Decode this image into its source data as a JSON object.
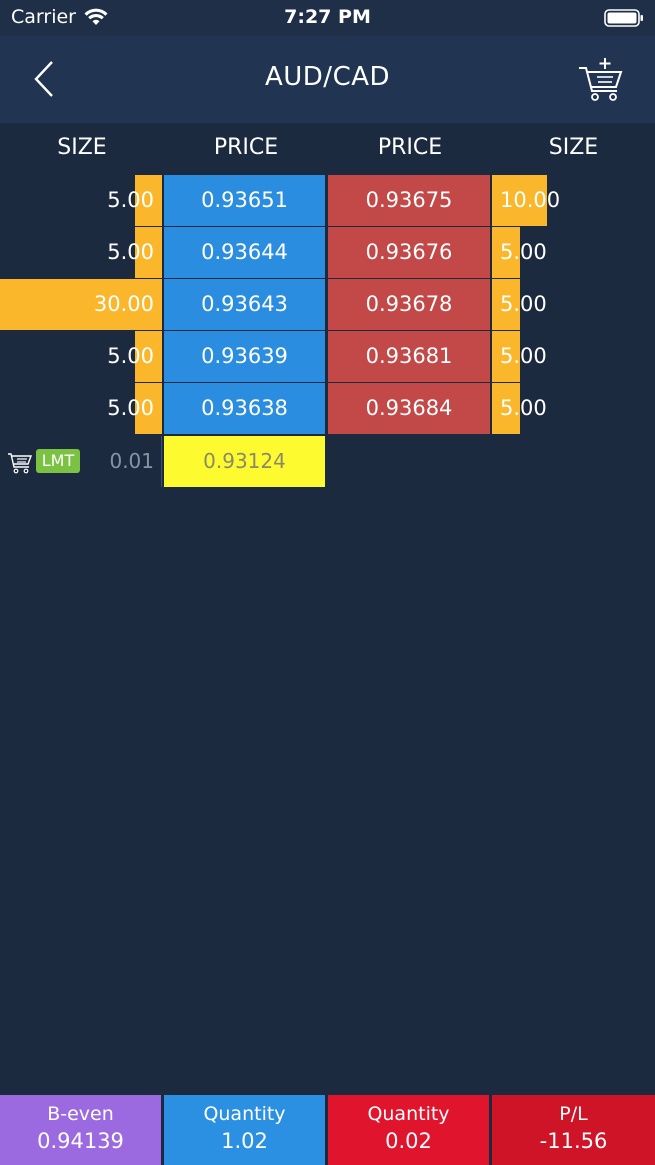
{
  "status_bar": {
    "carrier": "Carrier",
    "time": "7:27 PM"
  },
  "nav": {
    "title": "AUD/CAD"
  },
  "headers": {
    "bid_size": "SIZE",
    "bid_price": "PRICE",
    "ask_price": "PRICE",
    "ask_size": "SIZE"
  },
  "book": {
    "rows": [
      {
        "bid_size": "5.00",
        "bid_price": "0.93651",
        "ask_price": "0.93675",
        "ask_size": "10.00"
      },
      {
        "bid_size": "5.00",
        "bid_price": "0.93644",
        "ask_price": "0.93676",
        "ask_size": "5.00"
      },
      {
        "bid_size": "30.00",
        "bid_price": "0.93643",
        "ask_price": "0.93678",
        "ask_size": "5.00"
      },
      {
        "bid_size": "5.00",
        "bid_price": "0.93639",
        "ask_price": "0.93681",
        "ask_size": "5.00"
      },
      {
        "bid_size": "5.00",
        "bid_price": "0.93638",
        "ask_price": "0.93684",
        "ask_size": "5.00"
      }
    ]
  },
  "order": {
    "badge": "LMT",
    "size": "0.01",
    "price": "0.93124"
  },
  "footer": {
    "b_even": {
      "label": "B-even",
      "value": "0.94139"
    },
    "buy_qty": {
      "label": "Quantity",
      "value": "1.02"
    },
    "sell_qty": {
      "label": "Quantity",
      "value": "0.02"
    },
    "pl": {
      "label": "P/L",
      "value": "-11.56"
    }
  },
  "colors": {
    "background": "#1c2a40",
    "bid": "#2a8de0",
    "ask": "#c24948",
    "size_bar": "#fbb72c",
    "limit_order": "#fdfb30",
    "lmt_badge": "#7cc242",
    "b_even": "#9c6ae0",
    "buy_qty": "#2b8fe2",
    "sell_qty": "#e0142c",
    "pl": "#d01428"
  }
}
